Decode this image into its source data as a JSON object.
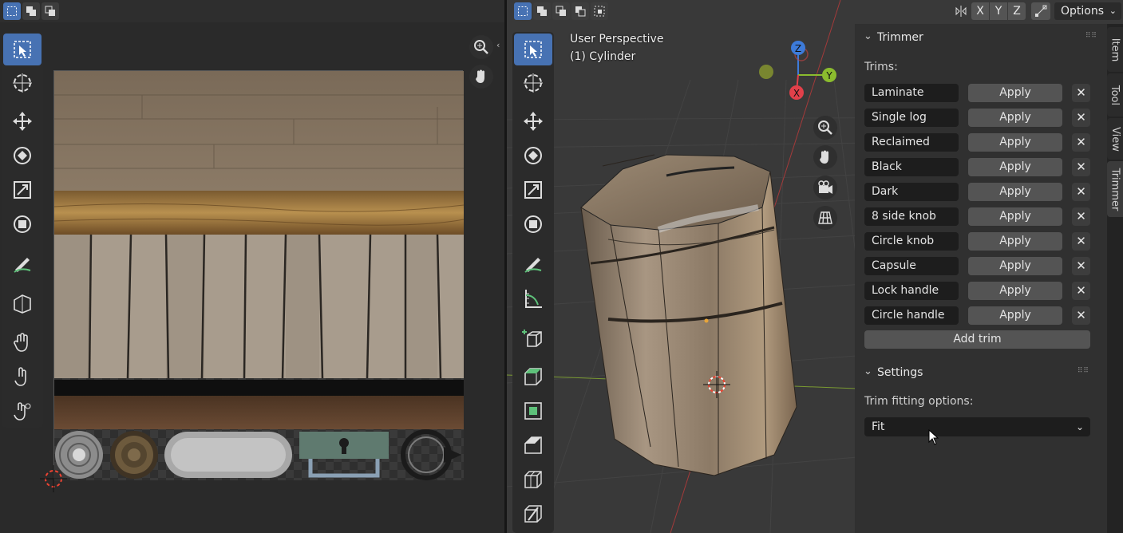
{
  "uv_editor": {
    "header_icons": [
      "select-box-icon",
      "select-extend-icon",
      "select-subtract-icon"
    ],
    "toolbar": [
      "select-cursor-icon",
      "cursor-tool-icon",
      "move-icon",
      "rotate-icon",
      "scale-icon",
      "transform-icon",
      "annotate-icon",
      "rip-icon",
      "grab-icon",
      "relax-icon",
      "pinch-icon"
    ]
  },
  "viewport": {
    "overlay": {
      "perspective": "User Perspective",
      "object": "(1) Cylinder"
    },
    "gizmo": {
      "z": "Z",
      "y": "Y",
      "x": "X"
    },
    "axis_buttons": [
      "X",
      "Y",
      "Z"
    ],
    "options_label": "Options",
    "toolbar": [
      "select-cursor-icon",
      "cursor-tool-icon",
      "move-icon",
      "rotate-icon",
      "scale-icon",
      "transform-icon",
      "annotate-icon",
      "measure-icon",
      "add-cube-icon",
      "extrude-icon",
      "inset-icon",
      "bevel-icon",
      "loop-cut-icon",
      "knife-icon"
    ]
  },
  "trimmer": {
    "title": "Trimmer",
    "trims_label": "Trims:",
    "apply_label": "Apply",
    "remove_label": "✕",
    "trims": [
      "Laminate",
      "Single log",
      "Reclaimed",
      "Black",
      "Dark",
      "8 side knob",
      "Circle knob",
      "Capsule",
      "Lock handle",
      "Circle handle"
    ],
    "add_trim_label": "Add trim"
  },
  "settings": {
    "title": "Settings",
    "fitting_label": "Trim fitting options:",
    "fitting_value": "Fit"
  },
  "side_tabs": [
    "Item",
    "Tool",
    "View",
    "Trimmer"
  ]
}
